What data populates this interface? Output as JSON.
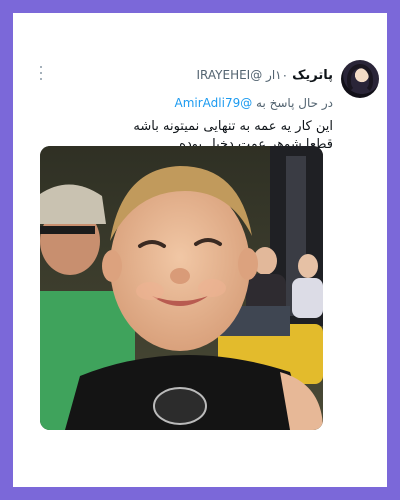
{
  "tweet": {
    "display_name": "پاتریک",
    "handle_line": "۱۰ار @IRAYEHEI",
    "reply_prefix": "در حال پاسخ به",
    "reply_mention": "@AmirAdli79",
    "text_lines": [
      "این کار یه عمه به تنهایی نمیتونه باشه",
      "قطعا شوهر عمت دخیل بوده"
    ]
  },
  "icons": {
    "more": "more-vertical-icon",
    "avatar": "profile-avatar"
  },
  "colors": {
    "page_border": "#7b68d9",
    "mention": "#1d9bf0",
    "secondary_text": "#536471"
  }
}
